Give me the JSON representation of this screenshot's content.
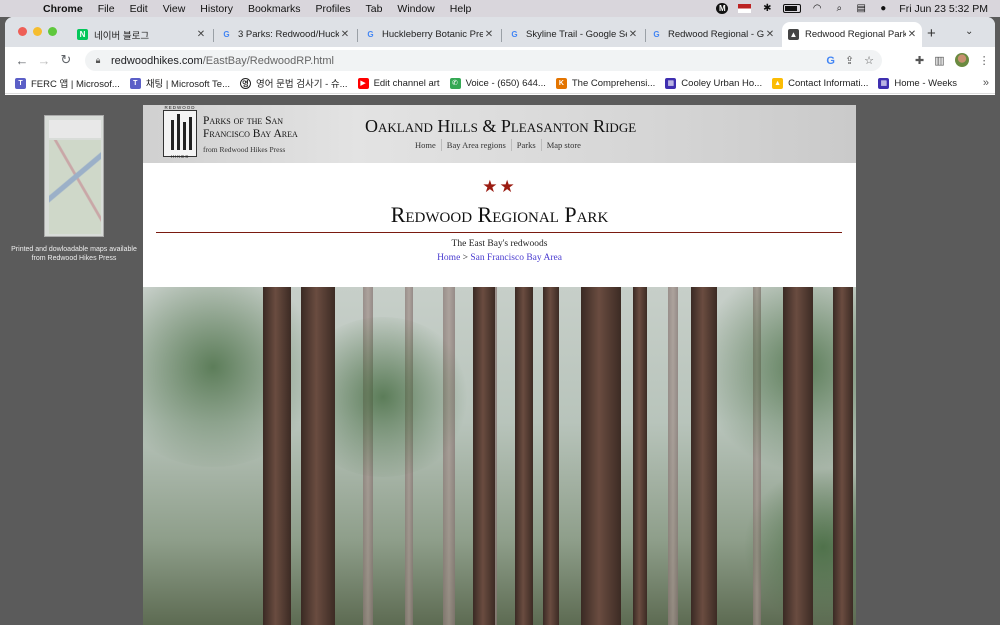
{
  "menubar": {
    "app": "Chrome",
    "items": [
      "File",
      "Edit",
      "View",
      "History",
      "Bookmarks",
      "Profiles",
      "Tab",
      "Window",
      "Help"
    ],
    "datetime": "Fri Jun 23  5:32 PM"
  },
  "tabs": [
    {
      "label": "네이버 블로그",
      "icon": "naver-icon",
      "color": "#03c75a"
    },
    {
      "label": "3 Parks: Redwood/Huckle",
      "icon": "google-icon",
      "color": "#4285f4"
    },
    {
      "label": "Huckleberry Botanic Pre",
      "icon": "google-icon",
      "color": "#4285f4"
    },
    {
      "label": "Skyline Trail - Google Se",
      "icon": "google-icon",
      "color": "#4285f4"
    },
    {
      "label": "Redwood Regional - Goo",
      "icon": "google-icon",
      "color": "#4285f4"
    },
    {
      "label": "Redwood Regional Park",
      "icon": "redwood-hikes-icon",
      "color": "#333333",
      "active": true
    }
  ],
  "address": {
    "host": "redwoodhikes.com",
    "path": "/EastBay/RedwoodRP.html"
  },
  "bookmarks": [
    {
      "label": "FERC 앱 | Microsof...",
      "icon": "teams-icon",
      "color": "#5b5fc7"
    },
    {
      "label": "채팅 | Microsoft Te...",
      "icon": "teams-icon",
      "color": "#5b5fc7"
    },
    {
      "label": "영어 문법 검사기 - 슈...",
      "icon": "grammar-icon",
      "color": "#222222"
    },
    {
      "label": "Edit channel art",
      "icon": "youtube-icon",
      "color": "#ff0000"
    },
    {
      "label": "Voice - (650) 644...",
      "icon": "voice-icon",
      "color": "#34a853"
    },
    {
      "label": "The Comprehensi...",
      "icon": "k-icon",
      "color": "#e37400"
    },
    {
      "label": "Cooley Urban Ho...",
      "icon": "calendar-icon",
      "color": "#3f2fb0"
    },
    {
      "label": "Contact Informati...",
      "icon": "drive-icon",
      "color": "#fbbc04"
    },
    {
      "label": "Home - Weeks",
      "icon": "calendar-icon",
      "color": "#3f2fb0"
    }
  ],
  "sidebar": {
    "map_caption": "Printed and dowloadable maps available from Redwood Hikes Press"
  },
  "banner": {
    "logo_text": "REDWOOD",
    "logo_bottom": "HIKES",
    "parks_title": "Parks of the San Francisco Bay Area",
    "parks_sub": "from Redwood Hikes Press",
    "site_title": "Oakland Hills & Pleasanton Ridge",
    "nav": [
      "Home",
      "Bay Area regions",
      "Parks",
      "Map store"
    ]
  },
  "park": {
    "stars": "★★",
    "title": "Redwood Regional Park",
    "tagline": "The East Bay's redwoods",
    "breadcrumb": {
      "home": "Home",
      "sep": ">",
      "region": "San Francisco Bay Area"
    }
  }
}
